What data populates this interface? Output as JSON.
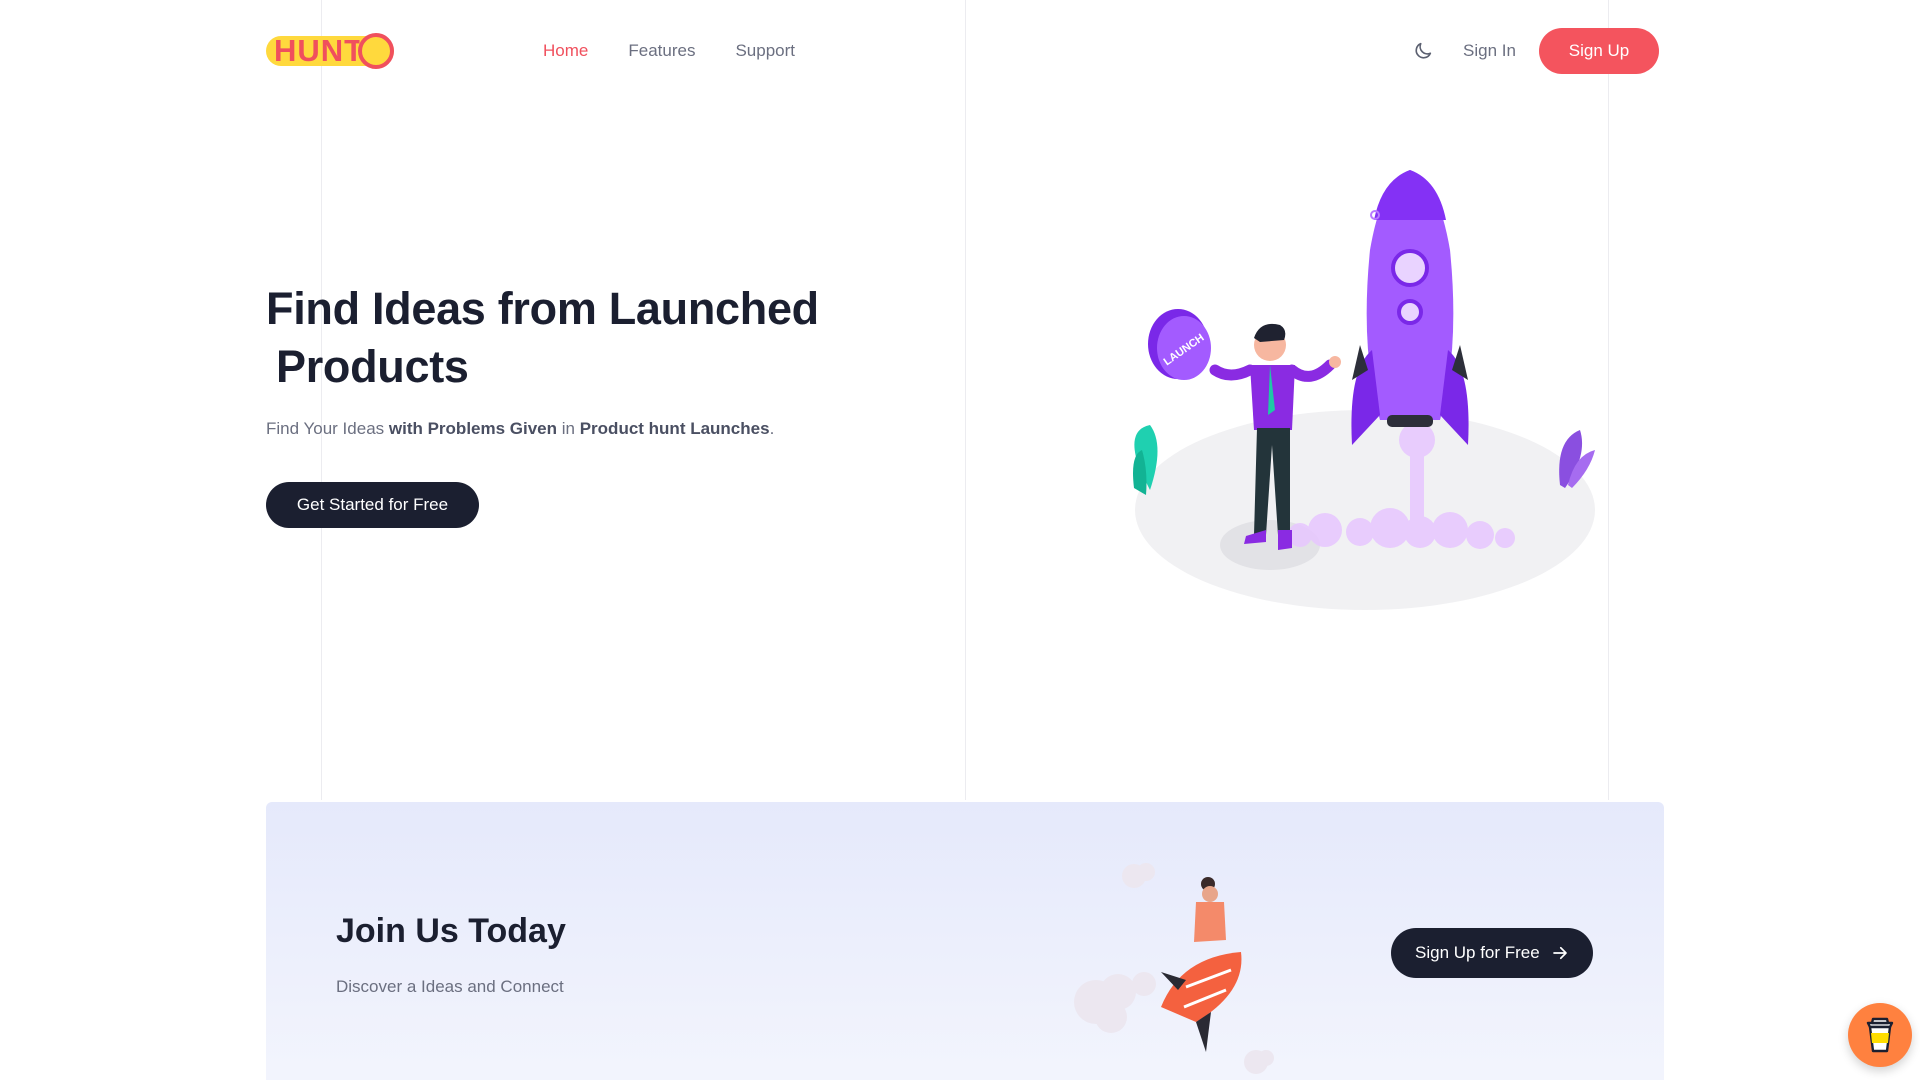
{
  "header": {
    "logo_text": "HUNTD",
    "nav": [
      {
        "label": "Home",
        "active": true
      },
      {
        "label": "Features",
        "active": false
      },
      {
        "label": "Support",
        "active": false
      }
    ],
    "theme_icon": "moon-icon",
    "sign_in": "Sign In",
    "sign_up": "Sign Up"
  },
  "hero": {
    "title_line1": "Find Ideas from Launched",
    "title_line2": "Products",
    "subtitle_parts": [
      {
        "text": "Find Your Ideas ",
        "bold": false
      },
      {
        "text": "with Problems Given",
        "bold": true
      },
      {
        "text": " in ",
        "bold": false
      },
      {
        "text": "Product hunt Launches",
        "bold": true
      },
      {
        "text": ".",
        "bold": false
      }
    ],
    "cta": "Get Started for Free",
    "illustration_badge": "LAUNCH"
  },
  "join": {
    "title": "Join Us Today",
    "subtitle": "Discover a Ideas and Connect",
    "button": "Sign Up for Free",
    "button_icon": "arrow-right-icon"
  },
  "colors": {
    "accent": "#f4545e",
    "dark": "#1b1f30",
    "logo_yellow": "#ffd93d",
    "rocket_purple": "#9b4dff",
    "coffee_orange": "#ff813f"
  },
  "floating": {
    "icon": "coffee-cup-icon"
  }
}
